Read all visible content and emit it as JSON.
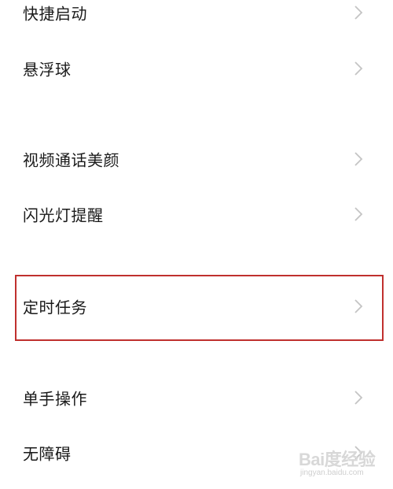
{
  "settings_list": {
    "items": [
      {
        "label": "快捷启动"
      },
      {
        "label": "悬浮球"
      },
      {
        "label": "视频通话美颜"
      },
      {
        "label": "闪光灯提醒"
      },
      {
        "label": "定时任务",
        "highlighted": true
      },
      {
        "label": "单手操作"
      },
      {
        "label": "无障碍"
      }
    ],
    "chevron_icon": "chevron-right-icon"
  },
  "annotation": {
    "highlight_color": "#c0302e"
  },
  "watermark": {
    "logo": "Bai度经验",
    "url": "jingyan.baidu.com"
  }
}
